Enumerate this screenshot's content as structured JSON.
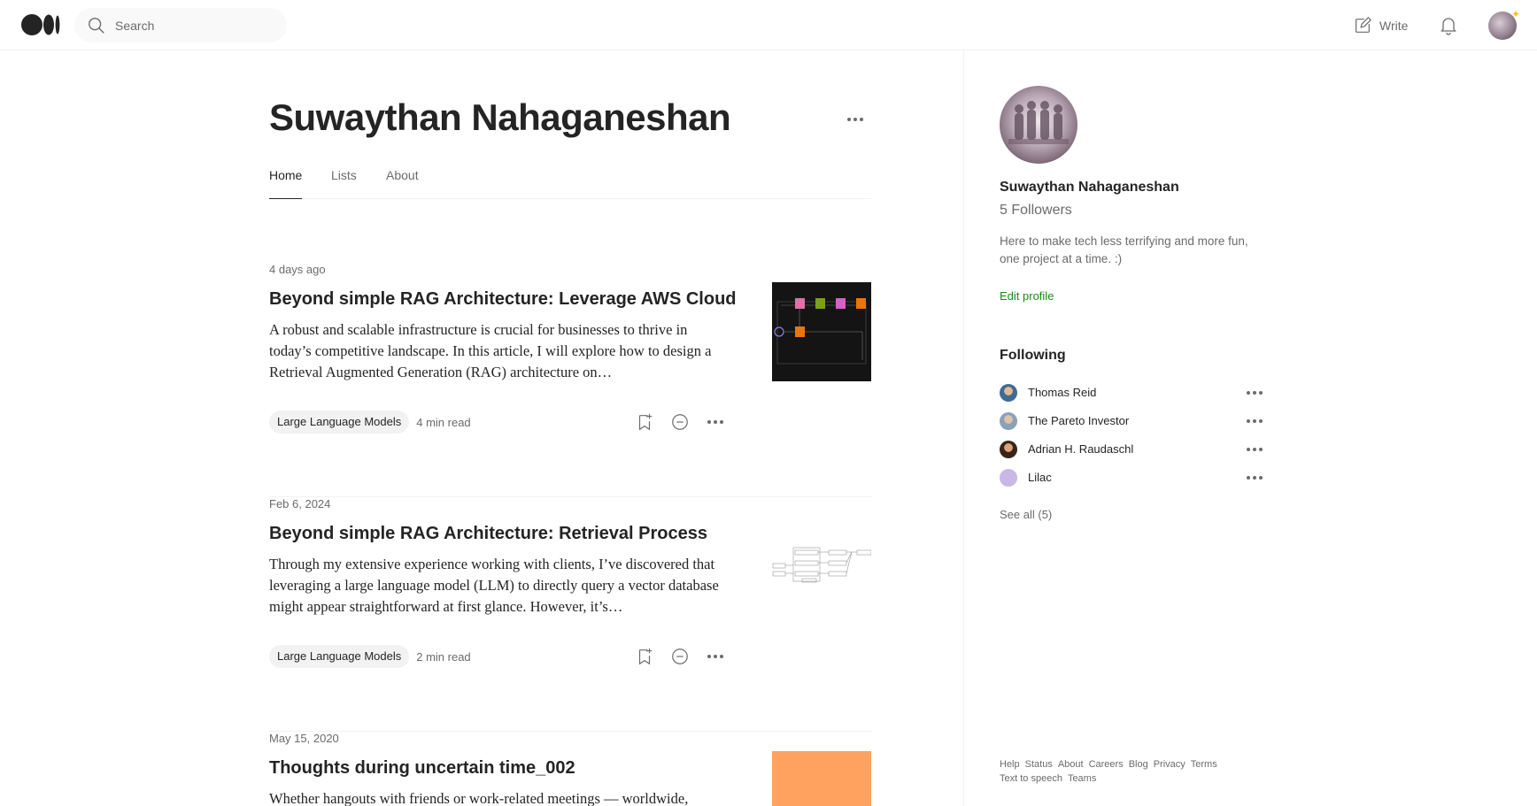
{
  "topbar": {
    "logo": "medium-logo",
    "search_placeholder": "Search",
    "write_label": "Write"
  },
  "profile": {
    "name": "Suwaythan Nahaganeshan",
    "tabs": [
      {
        "label": "Home",
        "active": true
      },
      {
        "label": "Lists",
        "active": false
      },
      {
        "label": "About",
        "active": false
      }
    ]
  },
  "articles": [
    {
      "date": "4 days ago",
      "title": "Beyond simple RAG Architecture: Leverage AWS Cloud",
      "subtitle": "A robust and scalable infrastructure is crucial for businesses to thrive in today’s competitive landscape. In this article, I will explore how to design a Retrieval Augmented Generation (RAG) architecture on…",
      "tag": "Large Language Models",
      "read_time": "4 min read"
    },
    {
      "date": "Feb 6, 2024",
      "title": "Beyond simple RAG Architecture: Retrieval Process",
      "subtitle": "Through my extensive experience working with clients, I’ve discovered that leveraging a large language model (LLM) to directly query a vector database might appear straightforward at first glance. However, it’s…",
      "tag": "Large Language Models",
      "read_time": "2 min read"
    },
    {
      "date": "May 15, 2020",
      "title": "Thoughts during uncertain time_002",
      "subtitle": "Whether hangouts with friends or work-related meetings — worldwide,"
    }
  ],
  "sidebar": {
    "name": "Suwaythan Nahaganeshan",
    "followers": "5 Followers",
    "bio": "Here to make tech less terrifying and more fun, one project at a time. :)",
    "edit_profile": "Edit profile",
    "following_title": "Following",
    "following": [
      {
        "name": "Thomas Reid",
        "color": "#6b7c93"
      },
      {
        "name": "The Pareto Investor",
        "color": "#8aa1b8"
      },
      {
        "name": "Adrian H. Raudaschl",
        "color": "#5a3a2a"
      },
      {
        "name": "Lilac",
        "color": "#c9b8e6"
      }
    ],
    "see_all": "See all (5)",
    "footer_links": [
      "Help",
      "Status",
      "About",
      "Careers",
      "Blog",
      "Privacy",
      "Terms",
      "Text to speech",
      "Teams"
    ]
  },
  "colors": {
    "accent_green": "#1a8917",
    "text_primary": "#242424",
    "text_secondary": "#6b6b6b",
    "thumb3": "#ffa15f"
  }
}
